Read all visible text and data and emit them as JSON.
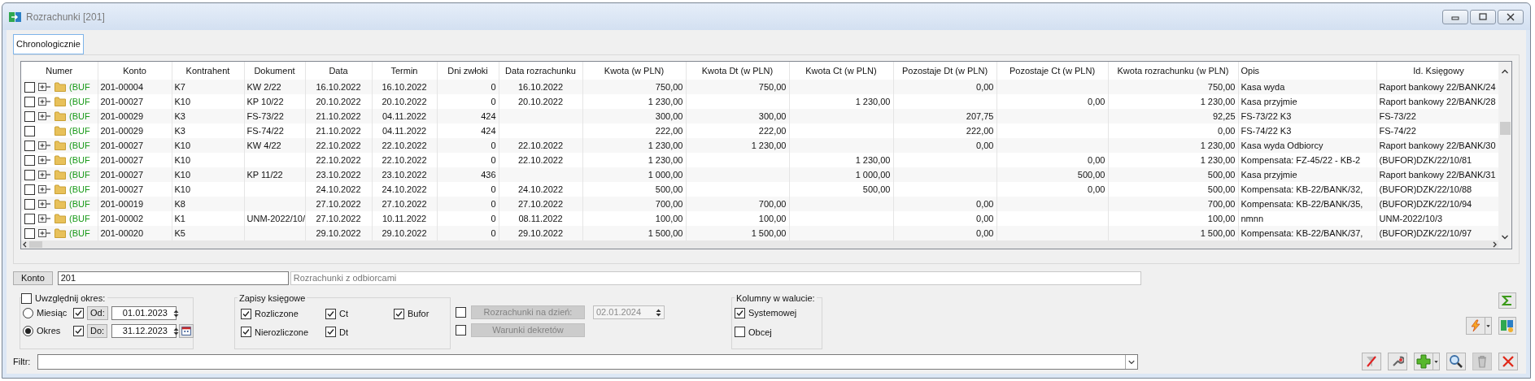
{
  "window": {
    "title": "Rozrachunki [201]"
  },
  "tabs": [
    {
      "label": "Chronologicznie",
      "selected": true
    }
  ],
  "table": {
    "columns": [
      "Numer",
      "Konto",
      "Kontrahent",
      "Dokument",
      "Data",
      "Termin",
      "Dni zwłoki",
      "Data rozrachunku",
      "Kwota (w PLN)",
      "Kwota Dt (w PLN)",
      "Kwota Ct (w PLN)",
      "Pozostaje Dt (w PLN)",
      "Pozostaje Ct (w PLN)",
      "Kwota rozrachunku (w PLN)",
      "Opis",
      "Id. Księgowy"
    ],
    "rows": [
      {
        "checked": false,
        "expandable": true,
        "cells": [
          "(BUF",
          "201-00004",
          "K7",
          "KW 2/22",
          "16.10.2022",
          "16.10.2022",
          "0",
          "16.10.2022",
          "750,00",
          "750,00",
          null,
          "0,00",
          null,
          "750,00",
          "Kasa wyda",
          "Raport bankowy 22/BANK/24"
        ]
      },
      {
        "checked": false,
        "expandable": true,
        "cells": [
          "(BUF",
          "201-00027",
          "K10",
          "KP 10/22",
          "20.10.2022",
          "20.10.2022",
          "0",
          "20.10.2022",
          "1 230,00",
          null,
          "1 230,00",
          null,
          "0,00",
          "1 230,00",
          "Kasa przyjmie",
          "Raport bankowy 22/BANK/28"
        ]
      },
      {
        "checked": false,
        "expandable": true,
        "cells": [
          "(BUF",
          "201-00029",
          "K3",
          "FS-73/22",
          "21.10.2022",
          "04.11.2022",
          "424",
          null,
          "300,00",
          "300,00",
          null,
          "207,75",
          null,
          "92,25",
          "FS-73/22 K3",
          "FS-73/22"
        ]
      },
      {
        "checked": false,
        "expandable": false,
        "cells": [
          "(BUF",
          "201-00029",
          "K3",
          "FS-74/22",
          "21.10.2022",
          "04.11.2022",
          "424",
          null,
          "222,00",
          "222,00",
          null,
          "222,00",
          null,
          "0,00",
          "FS-74/22 K3",
          "FS-74/22"
        ]
      },
      {
        "checked": false,
        "expandable": true,
        "cells": [
          "(BUF",
          "201-00027",
          "K10",
          "KW 4/22",
          "22.10.2022",
          "22.10.2022",
          "0",
          "22.10.2022",
          "1 230,00",
          "1 230,00",
          null,
          "0,00",
          null,
          "1 230,00",
          "Kasa wyda Odbiorcy",
          "Raport bankowy 22/BANK/30"
        ]
      },
      {
        "checked": false,
        "expandable": true,
        "cells": [
          "(BUF",
          "201-00027",
          "K10",
          null,
          "22.10.2022",
          "22.10.2022",
          "0",
          "22.10.2022",
          "1 230,00",
          null,
          "1 230,00",
          null,
          "0,00",
          "1 230,00",
          "Kompensata: FZ-45/22 - KB-2",
          "(BUFOR)DZK/22/10/81"
        ]
      },
      {
        "checked": false,
        "expandable": true,
        "cells": [
          "(BUF",
          "201-00027",
          "K10",
          "KP 11/22",
          "23.10.2022",
          "23.10.2022",
          "436",
          null,
          "1 000,00",
          null,
          "1 000,00",
          null,
          "500,00",
          "500,00",
          "Kasa przyjmie",
          "Raport bankowy 22/BANK/31"
        ]
      },
      {
        "checked": false,
        "expandable": true,
        "cells": [
          "(BUF",
          "201-00027",
          "K10",
          null,
          "24.10.2022",
          "24.10.2022",
          "0",
          "24.10.2022",
          "500,00",
          null,
          "500,00",
          null,
          "0,00",
          "500,00",
          "Kompensata: KB-22/BANK/32,",
          "(BUFOR)DZK/22/10/88"
        ]
      },
      {
        "checked": false,
        "expandable": true,
        "cells": [
          "(BUF",
          "201-00019",
          "K8",
          null,
          "27.10.2022",
          "27.10.2022",
          "0",
          "27.10.2022",
          "700,00",
          "700,00",
          null,
          "0,00",
          null,
          "700,00",
          "Kompensata: KB-22/BANK/35,",
          "(BUFOR)DZK/22/10/94"
        ]
      },
      {
        "checked": false,
        "expandable": true,
        "cells": [
          "(BUF",
          "201-00002",
          "K1",
          "UNM-2022/10/",
          "27.10.2022",
          "10.11.2022",
          "0",
          "08.11.2022",
          "100,00",
          "100,00",
          null,
          "0,00",
          null,
          "100,00",
          "nmnn",
          "UNM-2022/10/3"
        ]
      },
      {
        "checked": false,
        "expandable": true,
        "cells": [
          "(BUF",
          "201-00020",
          "K5",
          null,
          "29.10.2022",
          "29.10.2022",
          "0",
          "29.10.2022",
          "1 500,00",
          "1 500,00",
          null,
          "0,00",
          null,
          "1 500,00",
          "Kompensata: KB-22/BANK/37,",
          "(BUFOR)DZK/22/10/97"
        ]
      }
    ]
  },
  "konto": {
    "button": "Konto",
    "value": "201",
    "description": "Rozrachunki z odbiorcami"
  },
  "period": {
    "label": "Uwzględnij okres:",
    "checked": false,
    "modes": [
      {
        "label": "Miesiąc",
        "selected": false
      },
      {
        "label": "Okres",
        "selected": true
      }
    ],
    "from": {
      "button": "Od:",
      "checked": true,
      "value": "01.01.2023"
    },
    "to": {
      "button": "Do:",
      "checked": true,
      "value": "31.12.2023"
    }
  },
  "entries": {
    "title": "Zapisy księgowe",
    "options": [
      {
        "label": "Rozliczone",
        "checked": true
      },
      {
        "label": "Ct",
        "checked": true
      },
      {
        "label": "Bufor",
        "checked": true
      },
      {
        "label": "Nierozliczone",
        "checked": true
      },
      {
        "label": "Dt",
        "checked": true
      }
    ]
  },
  "settlement_date": {
    "checked": false,
    "button": "Rozrachunki na dzień:",
    "value": "02.01.2024",
    "disabled": true
  },
  "posting_conditions": {
    "checked": false,
    "button": "Warunki dekretów",
    "disabled": true
  },
  "currency_columns": {
    "title": "Kolumny w walucie:",
    "options": [
      {
        "label": "Systemowej",
        "checked": true
      },
      {
        "label": "Obcej",
        "checked": false
      }
    ]
  },
  "filter": {
    "label": "Filtr:"
  },
  "toolbar": [
    {
      "kind": "unfilter",
      "disabled": false
    },
    {
      "kind": "wrench",
      "disabled": false
    },
    {
      "kind": "add",
      "disabled": false
    },
    {
      "kind": "search",
      "disabled": false
    },
    {
      "kind": "delete",
      "disabled": true
    },
    {
      "kind": "close",
      "disabled": false
    }
  ]
}
